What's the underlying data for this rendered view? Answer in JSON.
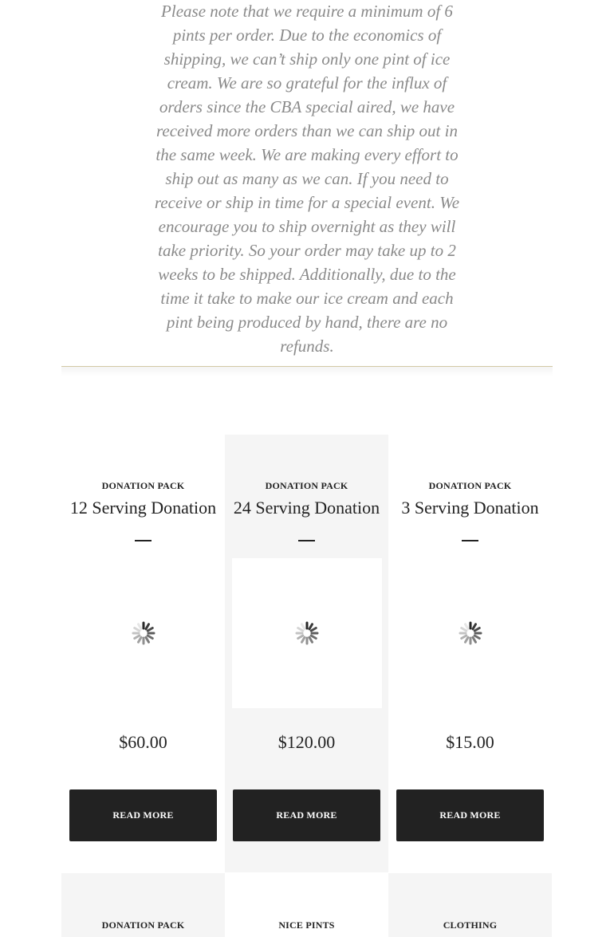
{
  "notice": {
    "text": "Please note that we require a minimum of 6 pints per order. Due to the economics of shipping, we can’t ship only one pint of ice cream.  We are so grateful for the influx of orders since the CBA special aired, we have received more orders than we can ship out in the same week. We are making every effort to ship out as many as we can. If you need to receive or ship in time for a special event. We encourage you to ship overnight as they will take priority. So your order may take up to 2 weeks to be shipped. Additionally, due to the time it take to make our ice cream and each pint being produced by hand, there are no refunds."
  },
  "products": [
    {
      "category": "DONATION PACK",
      "title": "12 Serving Donation",
      "price": "$60.00",
      "button": "READ MORE"
    },
    {
      "category": "DONATION PACK",
      "title": "24 Serving Donation",
      "price": "$120.00",
      "button": "READ MORE"
    },
    {
      "category": "DONATION PACK",
      "title": "3 Serving Donation",
      "price": "$15.00",
      "button": "READ MORE"
    }
  ],
  "next_row": [
    {
      "category": "DONATION PACK"
    },
    {
      "category": "NICE PINTS"
    },
    {
      "category": "CLOTHING"
    }
  ],
  "colors": {
    "button_bg": "#222222",
    "card_shade": "#f5f5f5",
    "rule": "#d2c9a4",
    "notice_text": "#8a8a8a"
  },
  "icons": {
    "image_placeholder": "loading-spinner-icon"
  }
}
